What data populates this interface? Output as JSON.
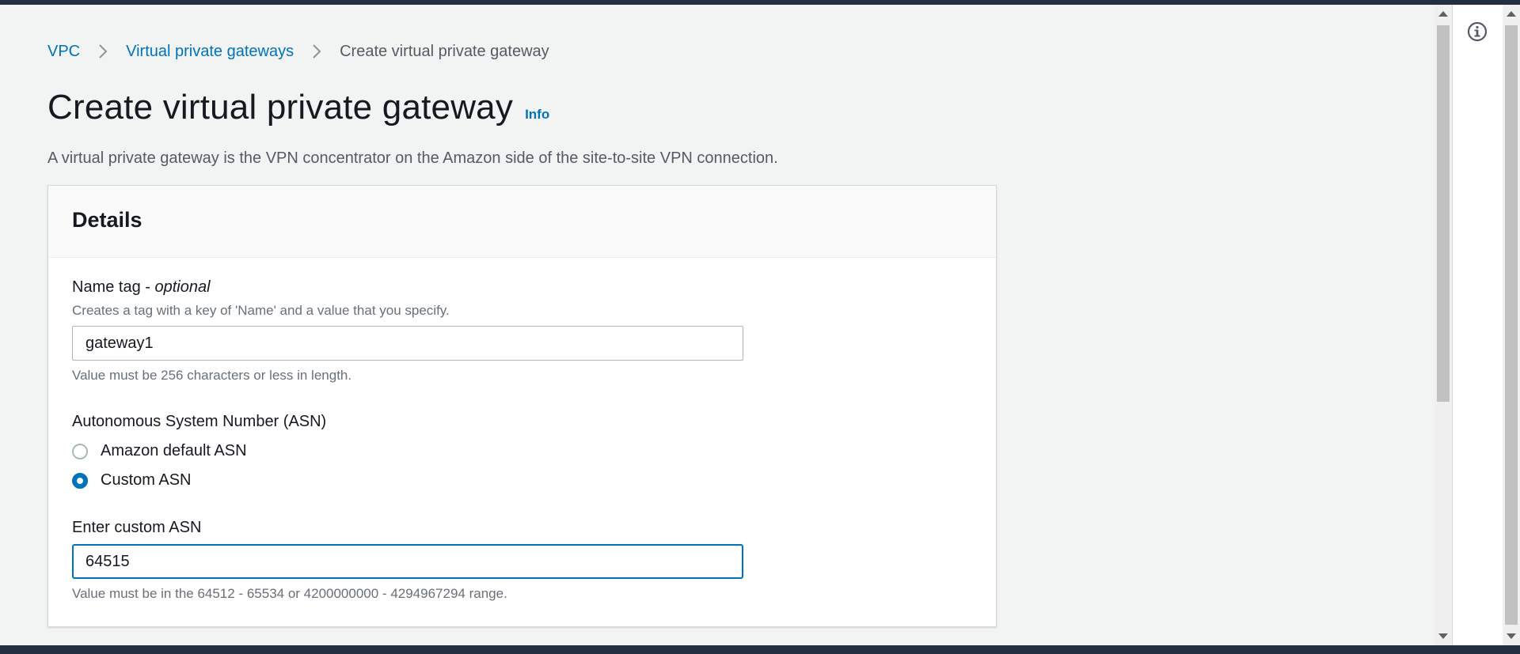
{
  "breadcrumb": {
    "items": [
      {
        "label": "VPC"
      },
      {
        "label": "Virtual private gateways"
      }
    ],
    "current": "Create virtual private gateway"
  },
  "page": {
    "title": "Create virtual private gateway",
    "info_label": "Info",
    "description": "A virtual private gateway is the VPN concentrator on the Amazon side of the site-to-site VPN connection."
  },
  "details": {
    "title": "Details",
    "name_tag": {
      "label": "Name tag - ",
      "label_optional": "optional",
      "description": "Creates a tag with a key of 'Name' and a value that you specify.",
      "value": "gateway1",
      "constraint": "Value must be 256 characters or less in length."
    },
    "asn": {
      "label": "Autonomous System Number (ASN)",
      "options": [
        {
          "label": "Amazon default ASN",
          "checked": false
        },
        {
          "label": "Custom ASN",
          "checked": true
        }
      ]
    },
    "custom_asn": {
      "label": "Enter custom ASN",
      "value": "64515",
      "constraint": "Value must be in the 64512 - 65534 or 4200000000 - 4294967294 range."
    }
  },
  "colors": {
    "link": "#0073bb",
    "header_bar": "#232f3e",
    "background": "#f2f3f3",
    "focus": "#0073bb"
  },
  "icons": {
    "breadcrumb_separator": "chevron-right-icon",
    "side_panel": "info-circle-icon"
  }
}
